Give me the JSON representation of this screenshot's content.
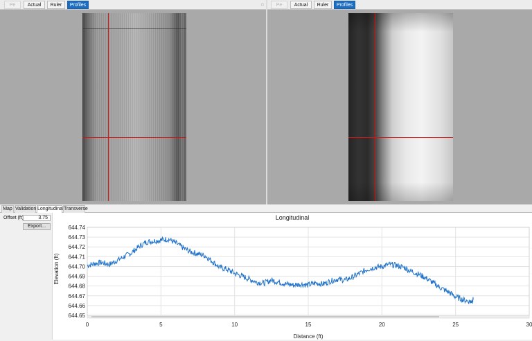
{
  "left_pane": {
    "toolbar": {
      "pe": "Pe",
      "actual": "Actual",
      "ruler": "Ruler",
      "profiles": "Profiles"
    },
    "pin_icon": "pin-icon"
  },
  "right_pane": {
    "toolbar": {
      "pe": "Pe",
      "actual": "Actual",
      "ruler": "Ruler",
      "profiles": "Profiles"
    }
  },
  "tabs": [
    {
      "label": "Map"
    },
    {
      "label": "Validation"
    },
    {
      "label": "Longitudinal",
      "active": true
    },
    {
      "label": "Transverse"
    }
  ],
  "side": {
    "offset_label": "Offset (ft)",
    "offset_value": "3.75",
    "export_label": "Export..."
  },
  "colors": {
    "accent": "#1b6ec2",
    "series": "#1f72c8",
    "crosshair": "#e01010",
    "background": "#a9a9a9"
  },
  "chart_data": {
    "type": "line",
    "title": "Longitudinal",
    "xlabel": "Distance (ft)",
    "ylabel": "Elevation (ft)",
    "xlim": [
      0,
      30
    ],
    "ylim": [
      644.65,
      644.74
    ],
    "x_ticks": [
      "0",
      "5",
      "10",
      "15",
      "20",
      "25",
      "30"
    ],
    "y_ticks": [
      "644.65",
      "644.66",
      "644.67",
      "644.68",
      "644.69",
      "644.70",
      "644.71",
      "644.72",
      "644.73",
      "644.74"
    ],
    "grid": true,
    "series": [
      {
        "x": [
          0,
          0.5,
          1,
          1.5,
          2,
          2.5,
          3,
          3.5,
          4,
          4.5,
          5,
          5.5,
          6,
          6.5,
          7,
          7.5,
          8,
          8.5,
          9,
          9.5,
          10,
          10.5,
          11,
          11.5,
          12,
          12.5,
          13,
          13.5,
          14,
          14.5,
          15,
          15.5,
          16,
          16.5,
          17,
          17.5,
          18,
          18.5,
          19,
          19.5,
          20,
          20.5,
          21,
          21.5,
          22,
          22.5,
          23,
          23.5,
          24,
          24.5,
          25,
          25.5,
          26,
          26.2
        ],
        "y": [
          644.701,
          644.703,
          644.704,
          644.702,
          644.706,
          644.71,
          644.714,
          644.72,
          644.725,
          644.726,
          644.727,
          644.728,
          644.724,
          644.719,
          644.715,
          644.713,
          644.711,
          644.705,
          644.699,
          644.697,
          644.693,
          644.69,
          644.687,
          644.684,
          644.683,
          644.686,
          644.684,
          644.682,
          644.681,
          644.682,
          644.681,
          644.683,
          644.682,
          644.685,
          644.687,
          644.686,
          644.689,
          644.693,
          644.697,
          644.699,
          644.7,
          644.702,
          644.701,
          644.699,
          644.695,
          644.692,
          644.688,
          644.683,
          644.678,
          644.674,
          644.669,
          644.666,
          644.664,
          644.666
        ]
      }
    ]
  }
}
